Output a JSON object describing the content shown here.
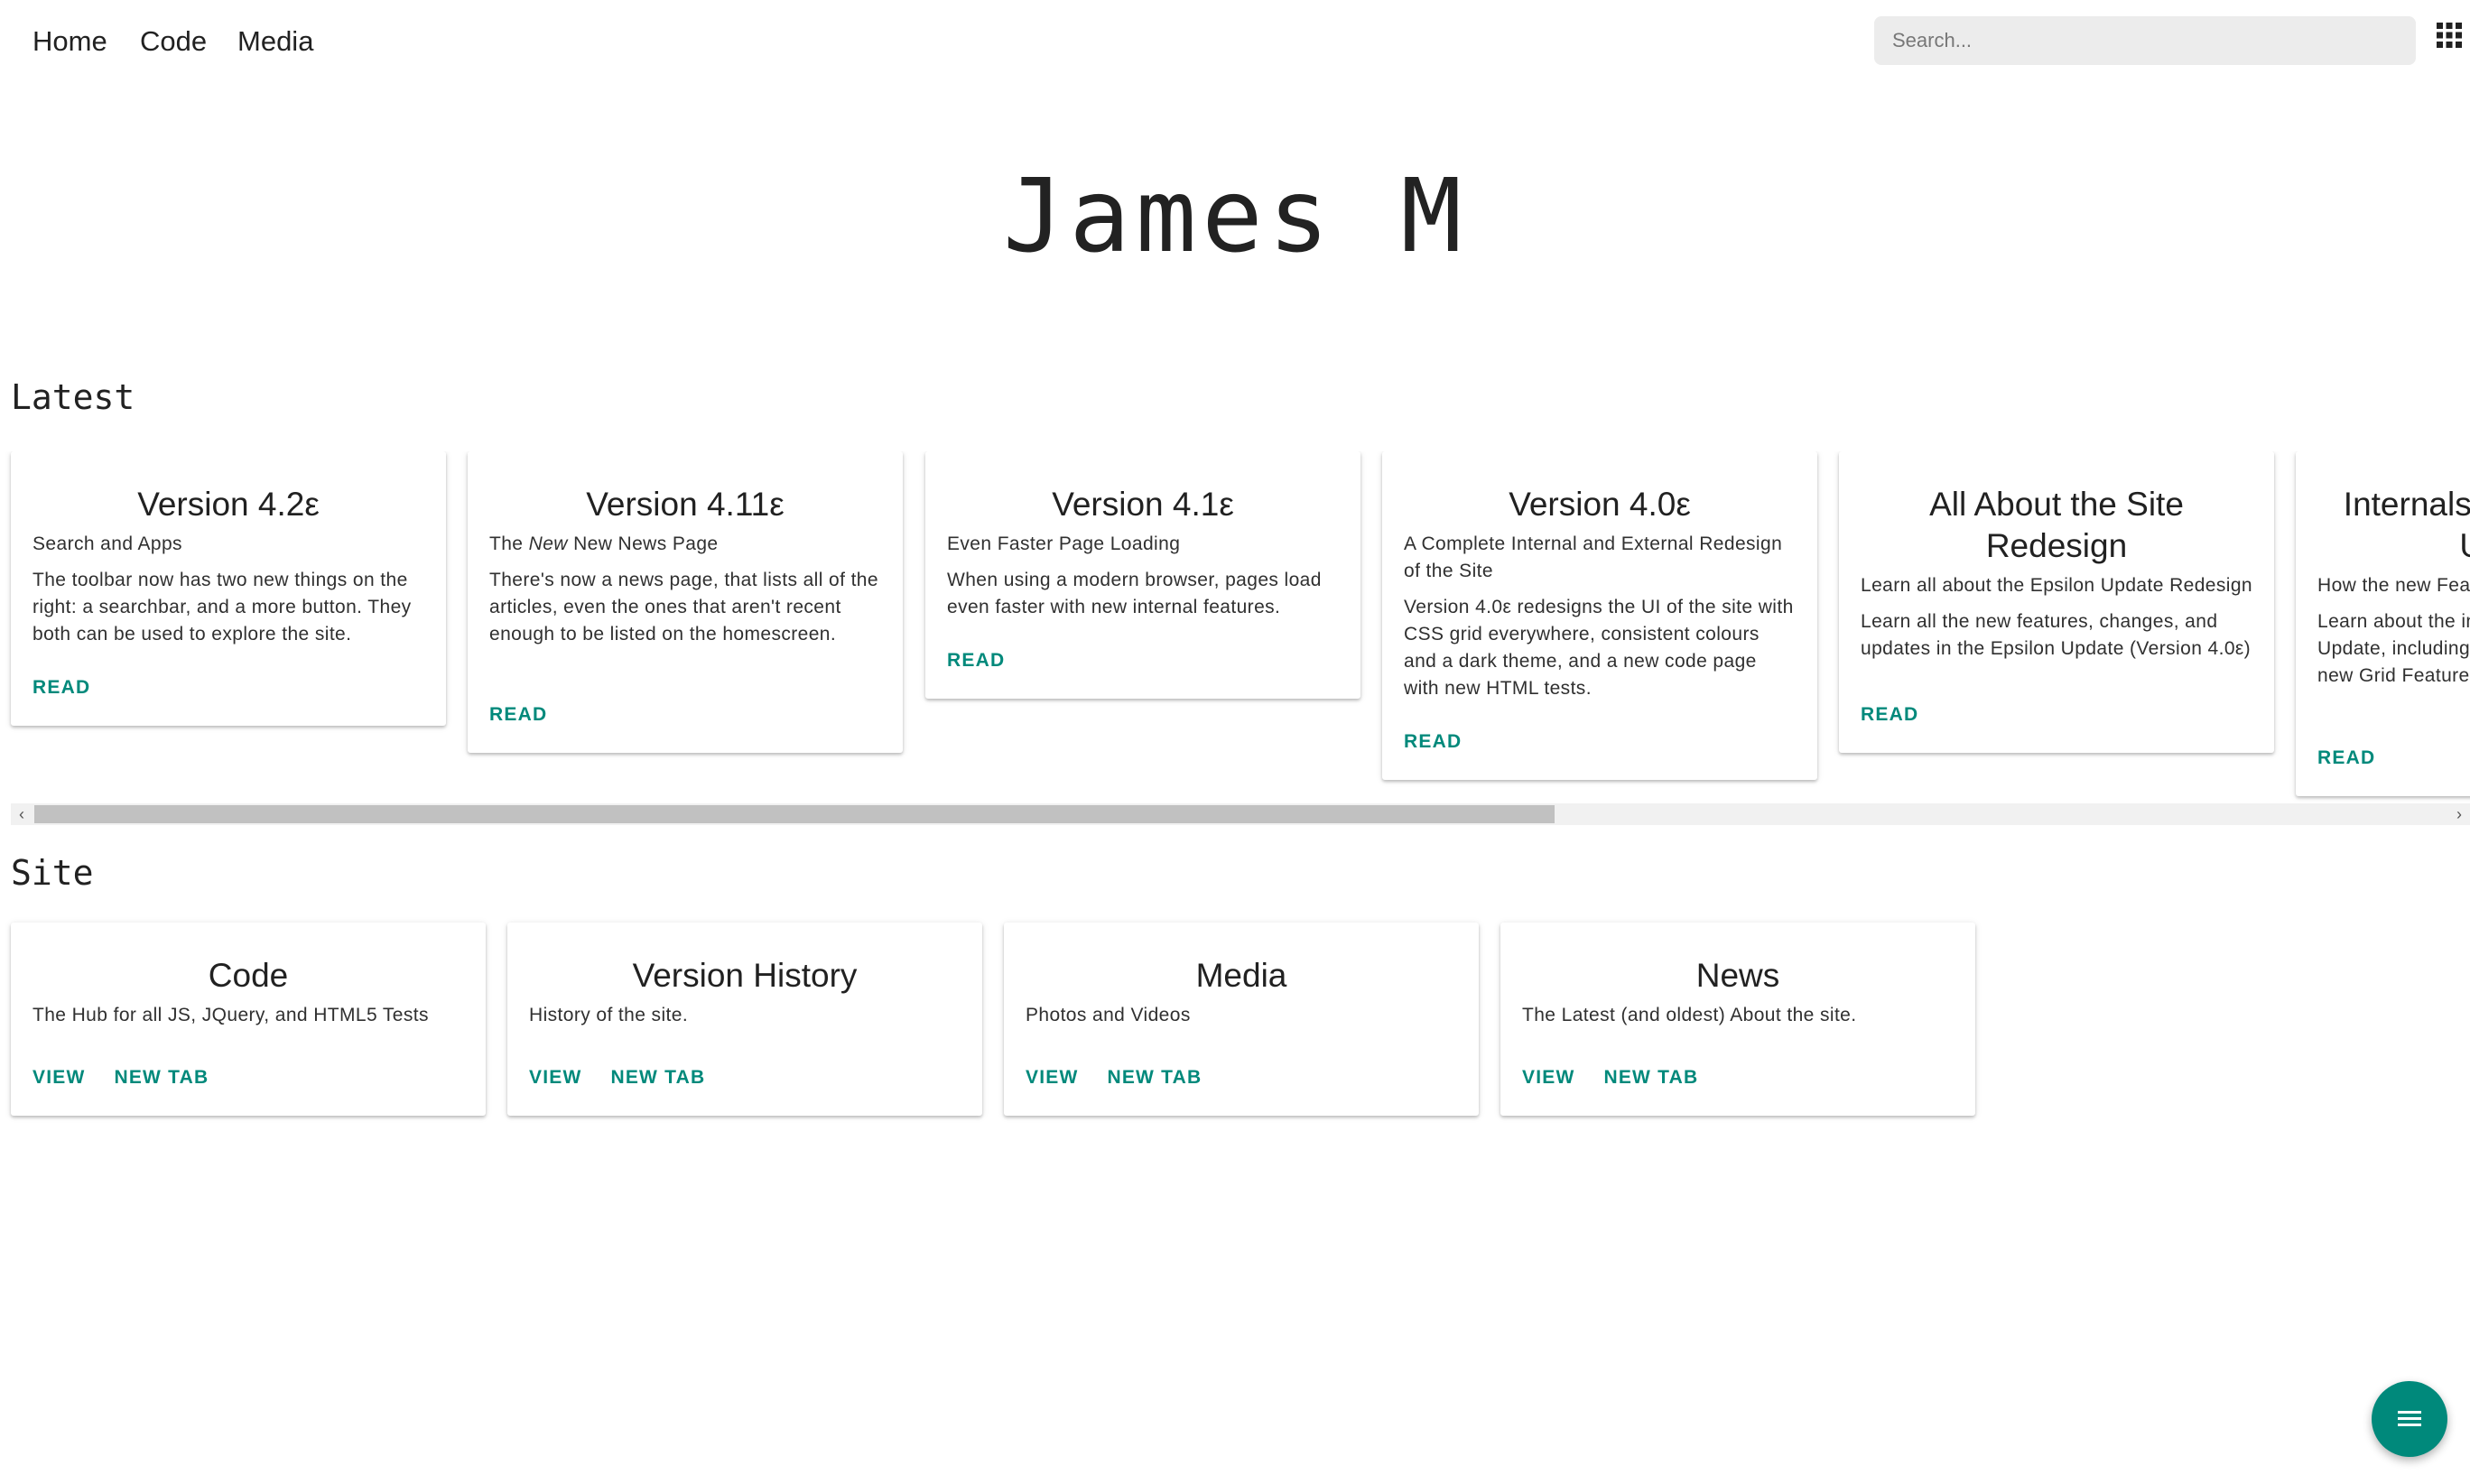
{
  "nav": {
    "items": [
      "Home",
      "Code",
      "Media"
    ]
  },
  "search": {
    "placeholder": "Search..."
  },
  "icons": {
    "apps": "apps-grid-icon",
    "fab": "menu-icon"
  },
  "hero": {
    "title": "James M"
  },
  "sections": {
    "latest": "Latest",
    "site": "Site"
  },
  "latest": [
    {
      "title": "Version 4.2ε",
      "subtitle": "Search and Apps",
      "text": "The toolbar now has two new things on the right: a searchbar, and a more button. They both can be used to explore the site.",
      "action": "READ"
    },
    {
      "title": "Version 4.11ε",
      "subtitle_pre": "The ",
      "subtitle_em": "New",
      "subtitle_post": " New News Page",
      "text": "There's now a news page, that lists all of the articles, even the ones that aren't recent enough to be listed on the homescreen.",
      "action": "READ"
    },
    {
      "title": "Version 4.1ε",
      "subtitle": "Even Faster Page Loading",
      "text": "When using a modern browser, pages load even faster with new internal features.",
      "action": "READ"
    },
    {
      "title": "Version 4.0ε",
      "subtitle": "A Complete Internal and External Redesign of the Site",
      "text": "Version 4.0ε redesigns the UI of the site with CSS grid everywhere, consistent colours and a dark theme, and a new code page with new HTML tests.",
      "action": "READ"
    },
    {
      "title": "All About the Site Redesign",
      "subtitle": "Learn all about the Epsilon Update Redesign",
      "text": "Learn all the new features, changes, and updates in the Epsilon Update (Version 4.0ε)",
      "action": "READ"
    },
    {
      "title": "Internals of the Epsilon Update",
      "subtitle": "How the new Features Work",
      "text": "Learn about the internals of the Epsilon Update, including animations, MDC, and the new Grid Features",
      "action": "READ"
    }
  ],
  "site": [
    {
      "title": "Code",
      "subtitle": "The Hub for all JS, JQuery, and HTML5 Tests",
      "view": "VIEW",
      "newtab": "NEW TAB"
    },
    {
      "title": "Version History",
      "subtitle": "History of the site.",
      "view": "VIEW",
      "newtab": "NEW TAB"
    },
    {
      "title": "Media",
      "subtitle": "Photos and Videos",
      "view": "VIEW",
      "newtab": "NEW TAB"
    },
    {
      "title": "News",
      "subtitle": "The Latest (and oldest) About the site.",
      "view": "VIEW",
      "newtab": "NEW TAB"
    }
  ],
  "scrollbar": {
    "left_arrow": "‹",
    "right_arrow": "›",
    "position": 0.61
  },
  "colors": {
    "accent": "#00897b",
    "background": "#ffffff",
    "search_bg": "#ececec"
  }
}
